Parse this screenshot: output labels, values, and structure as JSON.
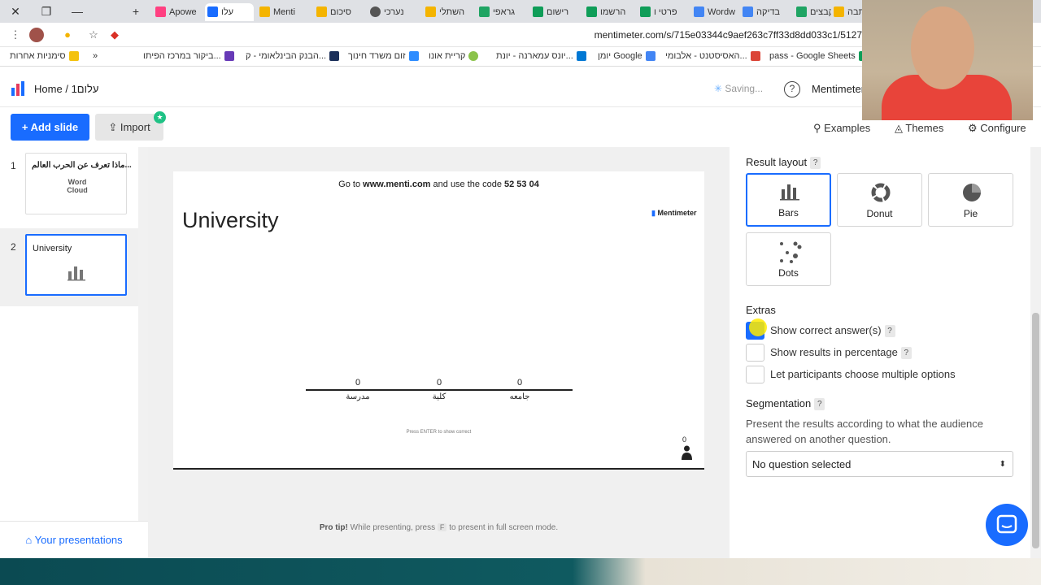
{
  "browser": {
    "tabs": [
      {
        "label": "הכתבה",
        "color": "#f4b400"
      },
      {
        "label": "קבצים",
        "color": "#1fa463"
      },
      {
        "label": "בדיקה",
        "color": "#4285f4"
      },
      {
        "label": "Wordw",
        "color": "#4285f4"
      },
      {
        "label": "פרטי ו",
        "color": "#0f9d58"
      },
      {
        "label": "הרשמו",
        "color": "#0f9d58"
      },
      {
        "label": "רישום",
        "color": "#0f9d58"
      },
      {
        "label": "גראפי",
        "color": "#1fa463"
      },
      {
        "label": "השתלי",
        "color": "#f4b400"
      },
      {
        "label": "נערכי",
        "color": "#555555"
      },
      {
        "label": "סיכום",
        "color": "#f4b400"
      },
      {
        "label": "Menti",
        "color": "#f4b400"
      },
      {
        "label": "עלו",
        "color": "#196cff"
      },
      {
        "label": "Apowe",
        "color": "#ff4081"
      }
    ],
    "url": "mentimeter.com/s/715e03344c9aef263c7ff33d8dd033c1/5127",
    "bookmarks": [
      {
        "label": "pass - Google Sheets",
        "color": "#0f9d58"
      },
      {
        "label": "האסיסטנט - אלבומי...",
        "color": "#db4437"
      },
      {
        "label": "יומן Google",
        "color": "#4285f4"
      },
      {
        "label": "יונס עמארנה - יונת...",
        "color": "#0078d4"
      },
      {
        "label": "קריית אונו",
        "color": "#8bc34a"
      },
      {
        "label": "זום משרד חינוך",
        "color": "#2d8cff"
      },
      {
        "label": "הבנק הבינלאומי - ק...",
        "color": "#1a2f5a"
      },
      {
        "label": "ביקור במרכז הפיתו...",
        "color": "#673ab7"
      },
      {
        "label": "סימניות אחרות",
        "color": "#f4c20d"
      }
    ],
    "bookmarks_more": "»"
  },
  "header": {
    "home": "Home",
    "separator": "/",
    "presentation": "עלום1",
    "saving": "Saving...",
    "help": "?",
    "brand": "Mentimeter"
  },
  "toolbar": {
    "add_slide": "+ Add slide",
    "import": "Import",
    "import_badge": "★",
    "examples": "Examples",
    "themes": "Themes",
    "configure": "Configure"
  },
  "slides": [
    {
      "num": "1",
      "title": "ماذا تعرف عن الحرب العالم...",
      "thumb_text": "Word Cloud"
    },
    {
      "num": "2",
      "title": "University"
    }
  ],
  "sidebar_footer": "Your presentations",
  "slide": {
    "goto_prefix": "Go to",
    "goto_url": "www.menti.com",
    "goto_mid": "and use the code",
    "goto_code": "52 53 04",
    "logo_text": "Mentimeter",
    "title": "University",
    "press_enter": "Press ENTER to show correct",
    "vote_count": "0"
  },
  "chart_data": {
    "type": "bar",
    "categories": [
      "مدرسة",
      "كلية",
      "جامعه"
    ],
    "values": [
      0,
      0,
      0
    ]
  },
  "protip": {
    "label": "Pro tip!",
    "text_before": "While presenting, press",
    "key": "F",
    "text_after": "to present in full screen mode."
  },
  "panel": {
    "result_layout_label": "Result layout",
    "layouts": [
      {
        "name": "Bars",
        "selected": true
      },
      {
        "name": "Donut",
        "selected": false
      },
      {
        "name": "Pie",
        "selected": false
      },
      {
        "name": "Dots",
        "selected": false
      }
    ],
    "extras_label": "Extras",
    "extras": [
      {
        "label": "Show correct answer(s)",
        "checked": true,
        "help": true
      },
      {
        "label": "Show results in percentage",
        "checked": false,
        "help": true
      },
      {
        "label": "Let participants choose multiple options",
        "checked": false,
        "help": false
      }
    ],
    "segmentation_label": "Segmentation",
    "segmentation_desc": "Present the results according to what the audience answered on another question.",
    "select_value": "No question selected"
  },
  "colors": {
    "accent": "#196cff",
    "badge": "#1fc285"
  }
}
